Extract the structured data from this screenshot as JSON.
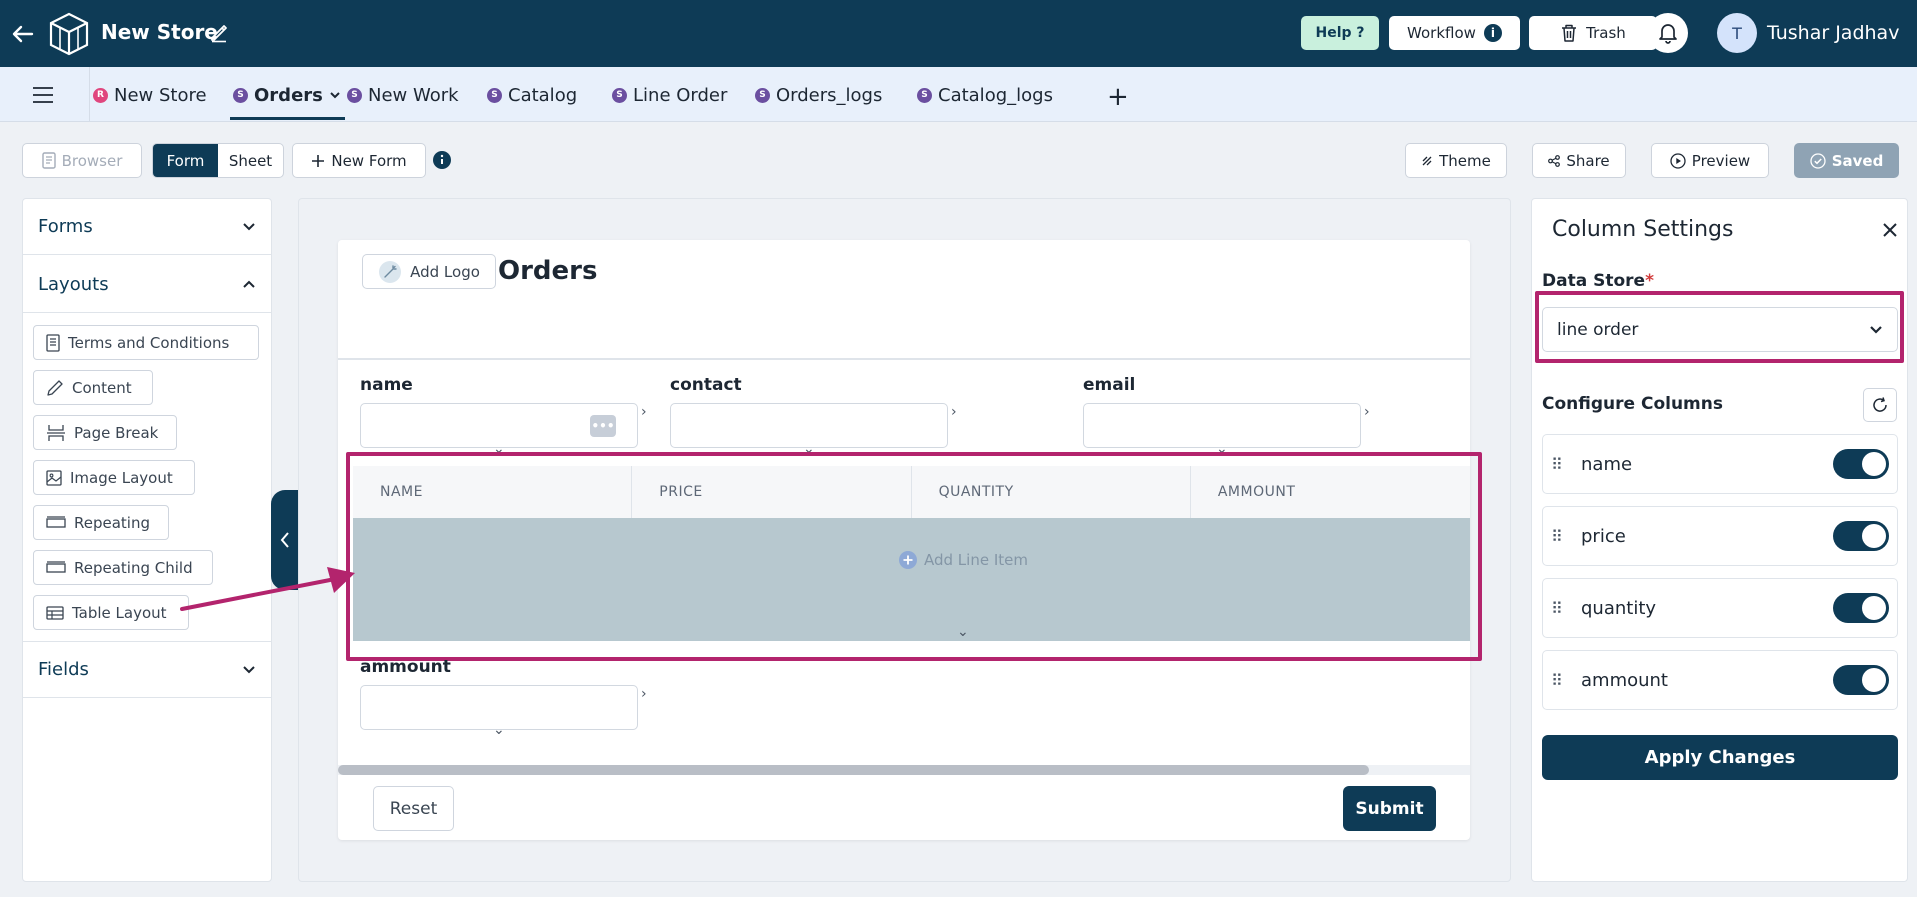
{
  "header": {
    "store_name": "New Store",
    "help_label": "Help ?",
    "workflow_label": "Workflow",
    "trash_label": "Trash",
    "avatar_initial": "T",
    "user_name": "Tushar Jadhav"
  },
  "tabs": [
    {
      "badge": "R",
      "label": "New Store"
    },
    {
      "badge": "S",
      "label": "Orders"
    },
    {
      "badge": "S",
      "label": "New Work"
    },
    {
      "badge": "S",
      "label": "Catalog"
    },
    {
      "badge": "S",
      "label": "Line Order"
    },
    {
      "badge": "S",
      "label": "Orders_logs"
    },
    {
      "badge": "S",
      "label": "Catalog_logs"
    }
  ],
  "active_tab": "Orders",
  "add_tab_label": "+",
  "toolbar": {
    "browser_label": "Browser",
    "form_label": "Form",
    "sheet_label": "Sheet",
    "new_form_label": "New Form",
    "theme_label": "Theme",
    "share_label": "Share",
    "preview_label": "Preview",
    "saved_label": "Saved"
  },
  "left_panel": {
    "forms_label": "Forms",
    "layouts_label": "Layouts",
    "fields_label": "Fields",
    "layout_items": [
      "Terms and Conditions",
      "Content",
      "Page Break",
      "Image Layout",
      "Repeating",
      "Repeating Child",
      "Table Layout"
    ]
  },
  "form": {
    "add_logo_label": "Add Logo",
    "title": "Orders",
    "fields": {
      "name": "name",
      "contact": "contact",
      "email": "email",
      "ammount": "ammount"
    },
    "table_columns": [
      "NAME",
      "PRICE",
      "QUANTITY",
      "AMMOUNT"
    ],
    "add_line_item_label": "Add Line Item",
    "reset_label": "Reset",
    "submit_label": "Submit"
  },
  "column_settings": {
    "title": "Column Settings",
    "data_store_label": "Data Store",
    "required_mark": "*",
    "data_store_value": "line order",
    "configure_label": "Configure Columns",
    "columns": [
      {
        "name": "name",
        "enabled": true
      },
      {
        "name": "price",
        "enabled": true
      },
      {
        "name": "quantity",
        "enabled": true
      },
      {
        "name": "ammount",
        "enabled": true
      }
    ],
    "apply_label": "Apply Changes"
  },
  "colors": {
    "primary": "#0e3b56",
    "highlight": "#b3246d",
    "table_body": "#b7c8cf",
    "help_bg": "#c9f0dd",
    "tab_bar_bg": "#e8f0fb"
  }
}
